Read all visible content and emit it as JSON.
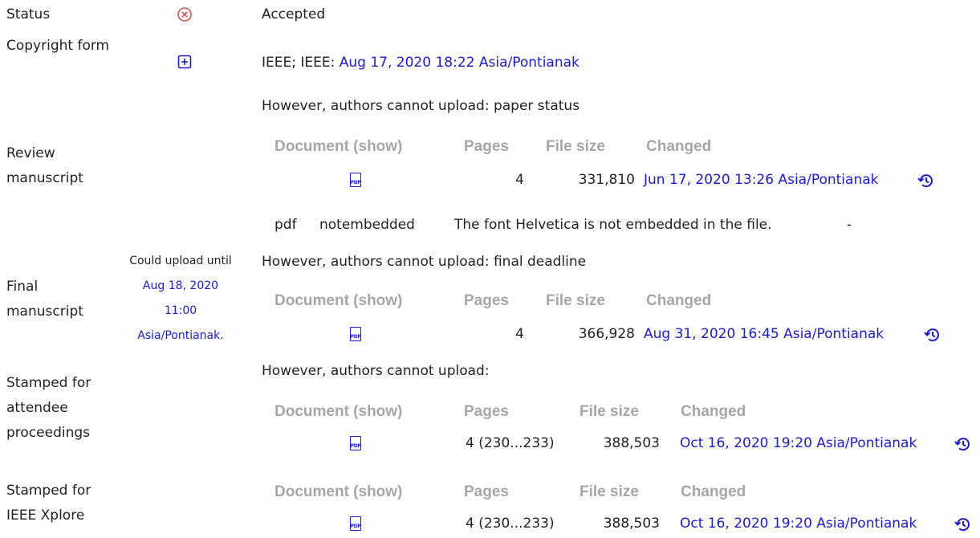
{
  "status": {
    "label": "Status",
    "value": "Accepted",
    "icon": "x-circle-icon",
    "icon_color": "#d9534f"
  },
  "copyright": {
    "label": "Copyright form",
    "value_prefix": "IEEE; IEEE: ",
    "value_link": "Aug 17, 2020 18:22 Asia/Pontianak",
    "icon": "plus-square-icon"
  },
  "review": {
    "label": "Review manuscript",
    "cannot_upload": "However, authors cannot upload: paper status",
    "headers": [
      "Document (show)",
      "Pages",
      "File size",
      "Changed"
    ],
    "row": {
      "pages": "4",
      "size": "331,810",
      "changed": "Jun 17, 2020 13:26 Asia/Pontianak"
    },
    "font_check": {
      "type": "pdf",
      "code": "notembedded",
      "message": "The font Helvetica is not embedded in the file.",
      "dash": "-"
    }
  },
  "final": {
    "label": "Final manuscript",
    "note_prefix": "Could upload until ",
    "note_link": "Aug 18, 2020 11:00 Asia/Pontianak",
    "note_suffix": ".",
    "cannot_upload": "However, authors cannot upload: final deadline",
    "headers": [
      "Document (show)",
      "Pages",
      "File size",
      "Changed"
    ],
    "row": {
      "pages": "4",
      "size": "366,928",
      "changed": "Aug 31, 2020 16:45 Asia/Pontianak"
    }
  },
  "stamped_attendee": {
    "label": "Stamped for attendee proceedings",
    "cannot_upload": "However, authors cannot upload:",
    "headers": [
      "Document (show)",
      "Pages",
      "File size",
      "Changed"
    ],
    "row": {
      "pages": "4 (230...233)",
      "size": "388,503",
      "changed": "Oct 16, 2020 19:20 Asia/Pontianak"
    }
  },
  "stamped_xplore": {
    "label": "Stamped for IEEE Xplore",
    "headers": [
      "Document (show)",
      "Pages",
      "File size",
      "Changed"
    ],
    "row": {
      "pages": "4 (230...233)",
      "size": "388,503",
      "changed": "Oct 16, 2020 19:20 Asia/Pontianak"
    }
  }
}
